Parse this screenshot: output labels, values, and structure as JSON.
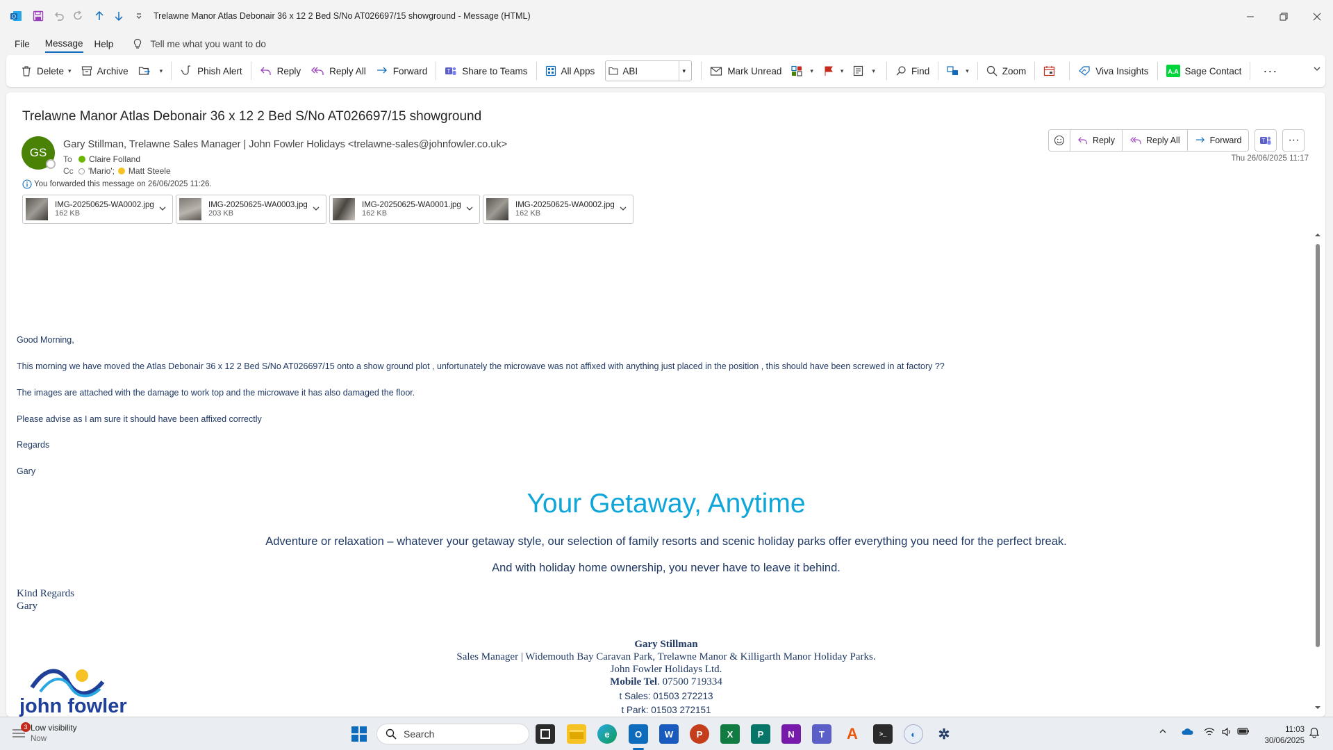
{
  "window": {
    "title": "Trelawne Manor Atlas Debonair  36 x 12 2 Bed S/No AT026697/15 showground  -  Message (HTML)"
  },
  "menu": {
    "file": "File",
    "message": "Message",
    "help": "Help",
    "tell_me": "Tell me what you want to do"
  },
  "ribbon": {
    "delete": "Delete",
    "archive": "Archive",
    "phish_alert": "Phish Alert",
    "reply": "Reply",
    "reply_all": "Reply All",
    "forward": "Forward",
    "share_teams": "Share to Teams",
    "all_apps": "All Apps",
    "folder_value": "ABI",
    "mark_unread": "Mark Unread",
    "find": "Find",
    "zoom": "Zoom",
    "viva": "Viva Insights",
    "sage": "Sage Contact"
  },
  "message": {
    "subject": "Trelawne Manor Atlas Debonair  36 x 12 2 Bed S/No AT026697/15 showground",
    "avatar_initials": "GS",
    "from": "Gary Stillman, Trelawne Sales Manager | John Fowler Holidays <trelawne-sales@johnfowler.co.uk>",
    "to_label": "To",
    "to": "Claire Folland",
    "cc_label": "Cc",
    "cc1": "'Mario';",
    "cc2": "Matt Steele",
    "forward_info": "You forwarded this message on 26/06/2025 11:26.",
    "date": "Thu 26/06/2025 11:17",
    "actions": {
      "reply": "Reply",
      "reply_all": "Reply All",
      "forward": "Forward"
    },
    "attachments": [
      {
        "name": "IMG-20250625-WA0002.jpg",
        "size": "162 KB"
      },
      {
        "name": "IMG-20250625-WA0003.jpg",
        "size": "203 KB"
      },
      {
        "name": "IMG-20250625-WA0001.jpg",
        "size": "162 KB"
      },
      {
        "name": "IMG-20250625-WA0002.jpg",
        "size": "162 KB"
      }
    ],
    "body": {
      "greeting": "Good Morning,",
      "p1": "This morning we have moved the Atlas Debonair  36 x 12 2 Bed S/No AT026697/15 onto a show ground plot , unfortunately the microwave was not affixed with anything just placed in the position , this should have been screwed in at factory ??",
      "p2": "The images are attached with the damage to work top and the microwave it has also damaged the floor.",
      "p3": "Please advise as I am sure it should have been affixed correctly",
      "regards": "Regards",
      "name": "Gary",
      "promo_title": "Your Getaway, Anytime",
      "promo_line1": "Adventure or relaxation – whatever your getaway style, our selection of family resorts and scenic holiday parks offer everything you need for the perfect break.",
      "promo_line2": "And with holiday home ownership, you never have to leave it behind.",
      "kind_regards": "Kind Regards",
      "kind_name": "Gary",
      "sig_name": "Gary Stillman",
      "sig_role": "Sales Manager |  Widemouth Bay Caravan Park, Trelawne Manor & Killigarth Manor Holiday Parks.",
      "sig_company": "John Fowler Holidays Ltd.",
      "sig_mobile_label": "Mobile Tel",
      "sig_mobile": ". 07500 719334",
      "sig_sales": "t  Sales: 01503 272213",
      "sig_park": "t  Park: 01503 272151",
      "logo_text": "john fowler"
    }
  },
  "taskbar": {
    "weather_badge": "3",
    "weather_title": "Low visibility",
    "weather_sub": "Now",
    "search": "Search",
    "time": "11:03",
    "date": "30/06/2025"
  }
}
